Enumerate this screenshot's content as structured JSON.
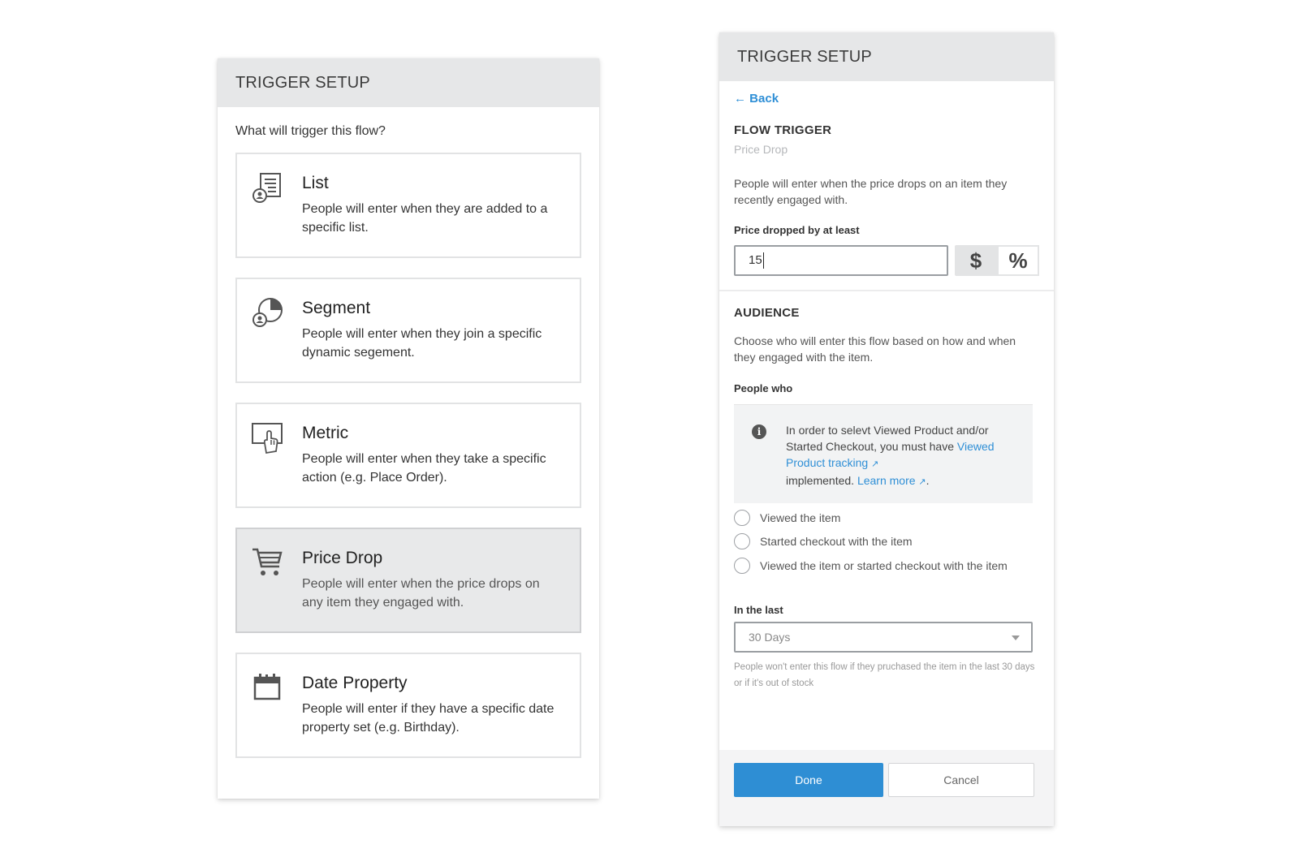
{
  "left_panel": {
    "header": "TRIGGER SETUP",
    "question": "What will trigger this flow?",
    "options": [
      {
        "icon": "list-icon",
        "title": "List",
        "description": "People will enter when they are added to a specific list.",
        "selected": false
      },
      {
        "icon": "segment-icon",
        "title": "Segment",
        "description": "People will enter when they join a specific dynamic segement.",
        "selected": false
      },
      {
        "icon": "metric-icon",
        "title": "Metric",
        "description": "People will enter when they take a specific action (e.g. Place Order).",
        "selected": false
      },
      {
        "icon": "cart-icon",
        "title": "Price Drop",
        "description": "People will enter when the price drops on any item they engaged with.",
        "selected": true
      },
      {
        "icon": "calendar-icon",
        "title": "Date Property",
        "description": "People will enter if they have a specific date property set (e.g. Birthday).",
        "selected": false
      }
    ]
  },
  "right_panel": {
    "header": "TRIGGER SETUP",
    "back_label": "Back",
    "flow_trigger": {
      "title": "FLOW TRIGGER",
      "value": "Price Drop",
      "description": "People will enter when the price drops on an item they recently engaged with."
    },
    "price_dropped": {
      "label": "Price dropped by at least",
      "value": "15",
      "units": [
        "$",
        "%"
      ],
      "active_unit": "%"
    },
    "audience": {
      "title": "AUDIENCE",
      "description": "Choose who will enter this flow based on how and when they engaged with the item.",
      "people_who_label": "People who",
      "info": {
        "text_1": "In order to selevt Viewed Product and/or Started Checkout, you must have ",
        "link_1": "Viewed Product tracking",
        "text_2": "implemented. ",
        "link_2": "Learn more",
        "text_3": "."
      },
      "radios": [
        {
          "label": "Viewed the item",
          "checked": false
        },
        {
          "label": "Started checkout with the item",
          "checked": false
        },
        {
          "label": "Viewed the item or started checkout with the item",
          "checked": false
        }
      ],
      "in_the_last_label": "In the last",
      "in_the_last_value": "30 Days",
      "help_text": "People won't enter this flow if they pruchased the item in the last 30 days or if it's out of stock"
    },
    "buttons": {
      "done": "Done",
      "cancel": "Cancel"
    }
  },
  "colors": {
    "accent": "#2e8ed4",
    "link": "#2f8fd6",
    "header_bg": "#e6e7e8",
    "selected_card_bg": "#e8e9ea"
  }
}
